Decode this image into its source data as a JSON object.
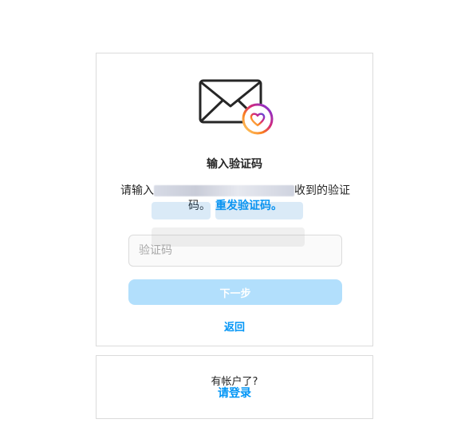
{
  "verify": {
    "title": "输入验证码",
    "desc_prefix": "请输入",
    "desc_suffix": "收到的验证码。",
    "resend_label": "重发验证码。",
    "code_placeholder": "验证码",
    "next_label": "下一步",
    "back_label": "返回"
  },
  "login": {
    "prompt": "有帐户了?",
    "link_label": "请登录"
  },
  "colors": {
    "accent": "#0095f6",
    "button_disabled": "#b2dffc",
    "border": "#dbdbdb"
  }
}
